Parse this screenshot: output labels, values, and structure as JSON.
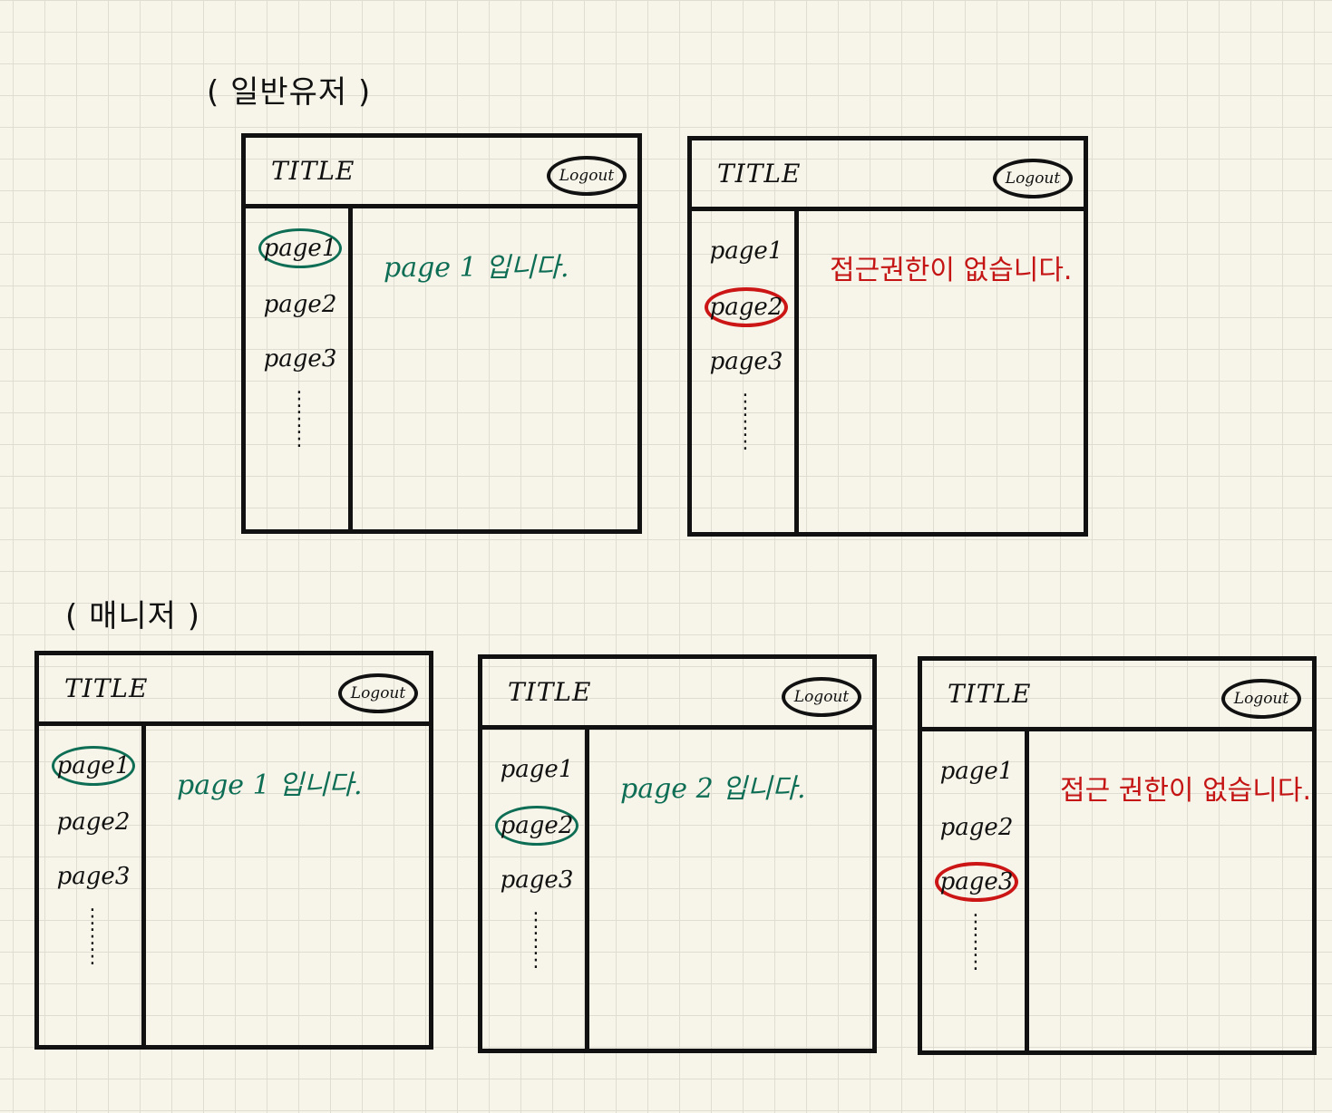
{
  "sections": {
    "general": "( 일반유저 )",
    "manager": "( 매니저 )"
  },
  "common": {
    "title": "TITLE",
    "logout": "Logout",
    "nav": [
      "page1",
      "page2",
      "page3"
    ],
    "ellipsis": "⋮"
  },
  "wireframes": [
    {
      "id": "w1",
      "message": "page 1 입니다.",
      "selected": "page1",
      "state": "allowed"
    },
    {
      "id": "w2",
      "message": "접근권한이 없습니다.",
      "selected": "page2",
      "state": "denied"
    },
    {
      "id": "w3",
      "message": "page 1 입니다.",
      "selected": "page1",
      "state": "allowed"
    },
    {
      "id": "w4",
      "message": "page 2 입니다.",
      "selected": "page2",
      "state": "allowed"
    },
    {
      "id": "w5",
      "message": "접근 권한이 없습니다.",
      "selected": "page3",
      "state": "denied"
    }
  ],
  "colors": {
    "allowed": "#0e6e55",
    "denied": "#cc1515",
    "ink": "#111111",
    "paper": "#f7f5e9"
  }
}
